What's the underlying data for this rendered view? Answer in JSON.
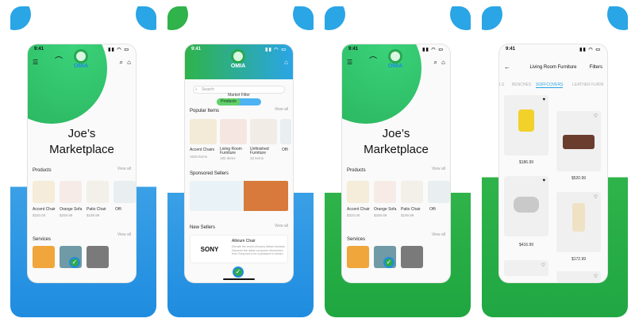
{
  "screens": [
    {
      "status_time": "9:41",
      "logo_text": "OMIA",
      "title_line1": "Joe’s",
      "title_line2": "Marketplace",
      "products_label": "Products",
      "view_all": "View all",
      "products": [
        {
          "name": "Accent Chair",
          "price": "$320.00"
        },
        {
          "name": "Orange Sofa",
          "price": "$259.99"
        },
        {
          "name": "Patio Chair",
          "price": "$199.99"
        },
        {
          "name": "Offi",
          "price": ""
        }
      ],
      "services_label": "Services",
      "services_view_all": "View all"
    },
    {
      "status_time": "9:41",
      "logo_text": "OMIA",
      "search_placeholder": "Search",
      "market_filter": "Market Filter",
      "toggle_label": "Products",
      "popular_label": "Popular Items",
      "popular_view_all": "View all",
      "popular": [
        {
          "name": "Accent Chairs",
          "count": "1520 items"
        },
        {
          "name": "Living Room Furniture",
          "count": "182 items"
        },
        {
          "name": "Unfinished Furniture",
          "count": "33 items"
        },
        {
          "name": "Offi",
          "count": ""
        }
      ],
      "sponsored_label": "Sponsored Sellers",
      "new_sellers_label": "New Sellers",
      "new_sellers_view_all": "View all",
      "new_seller": {
        "brand": "SONY",
        "title": "Allnium Chair",
        "desc": "Elevate the world of luxury Italian furniture. Discover the latest consumer electronics from Sony and a for a pleasure to dream."
      }
    },
    {
      "status_time": "9:41",
      "logo_text": "OMIA",
      "title_line1": "Joe’s",
      "title_line2": "Marketplace",
      "products_label": "Products",
      "view_all": "View all",
      "products": [
        {
          "name": "Accent Chair",
          "price": "$320.00"
        },
        {
          "name": "Orange Sofa",
          "price": "$259.99"
        },
        {
          "name": "Patio Chair",
          "price": "$199.99"
        },
        {
          "name": "Offi",
          "price": ""
        }
      ],
      "services_label": "Services",
      "services_view_all": "View all"
    },
    {
      "status_time": "9:41",
      "back_icon": "arrow-left-icon",
      "header_title": "Living Room Furniture",
      "filters_label": "Filters",
      "tabs": [
        "LS",
        "BENCHES",
        "SOFFCOVERS",
        "LEATHER FURNI"
      ],
      "items": [
        {
          "price": "$186.99"
        },
        {
          "price": "$520.99"
        },
        {
          "price": "$416.99"
        },
        {
          "price": "$172.99"
        }
      ]
    }
  ],
  "colors": {
    "green": "#2fb34a",
    "blue": "#1f8ce0",
    "accent": "#2aa5e6"
  }
}
